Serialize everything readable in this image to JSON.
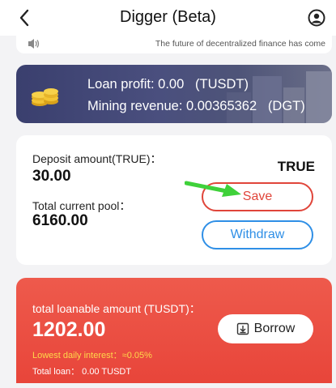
{
  "header": {
    "title": "Digger (Beta)"
  },
  "notice": {
    "text": "The future of decentralized finance has come"
  },
  "banner": {
    "loan_profit": "Loan profit: 0.00   (TUSDT)",
    "mining_revenue": "Mining revenue: 0.00365362   (DGT)"
  },
  "card": {
    "deposit_label": "Deposit amount(TRUE)：",
    "deposit_value": "30.00",
    "pool_label": "Total current pool：",
    "pool_value": "6160.00",
    "token": "TRUE",
    "save_label": "Save",
    "withdraw_label": "Withdraw"
  },
  "loan": {
    "title": "total loanable amount (TUSDT)：",
    "amount": "1202.00",
    "interest": "Lowest daily interest：≈0.05%",
    "total": "Total loan： 0.00 TUSDT",
    "borrow_label": "Borrow"
  },
  "colors": {
    "accent_red": "#e0453a",
    "accent_blue": "#2f8fe6",
    "banner_bg": "#3f4470",
    "interest_yellow": "#ffd84a"
  },
  "icons": [
    "back-arrow-icon",
    "profile-icon",
    "speaker-icon",
    "coins-icon",
    "borrow-icon",
    "pointer-arrow-icon"
  ]
}
